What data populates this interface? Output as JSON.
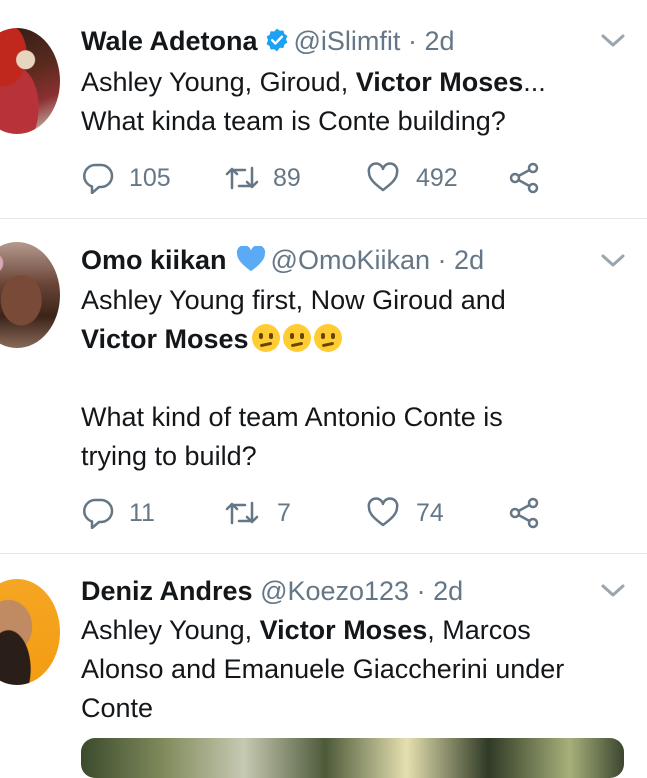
{
  "tweets": [
    {
      "name": "Wale Adetona",
      "verified": true,
      "handle": "@iSlimfit",
      "time": "2d",
      "lines": [
        [
          {
            "t": "Ashley Young, Giroud, "
          },
          {
            "t": "Victor Moses",
            "b": true
          },
          {
            "t": "..."
          }
        ],
        [
          {
            "t": "What kinda team is Conte building?"
          }
        ]
      ],
      "replies": "105",
      "retweets": "89",
      "likes": "492"
    },
    {
      "name": "Omo kiikan",
      "heart_badge": true,
      "handle": "@OmoKiikan",
      "time": "2d",
      "line1": "Ashley Young first, Now Giroud and",
      "line2_bold": "Victor Moses",
      "line3": "What kind of team Antonio Conte is",
      "line4": "trying to build?",
      "replies": "11",
      "retweets": "7",
      "likes": "74"
    },
    {
      "name": "Deniz Andres",
      "handle": "@Koezo123",
      "time": "2d",
      "line1_a": "Ashley Young, ",
      "line1_b": "Victor Moses",
      "line1_c": ", Marcos",
      "line2": "Alonso and Emanuele Giaccherini under",
      "line3": "Conte"
    }
  ],
  "separator": "·",
  "colors": {
    "verified": "#1da1f2",
    "heart": "#5aaaf5",
    "muted": "#657786",
    "divider": "#e1e8ed"
  },
  "icons": [
    "reply-icon",
    "retweet-icon",
    "like-icon",
    "share-icon",
    "chevron-down-icon",
    "verified-badge-icon",
    "blue-heart-icon",
    "confused-face-emoji"
  ]
}
